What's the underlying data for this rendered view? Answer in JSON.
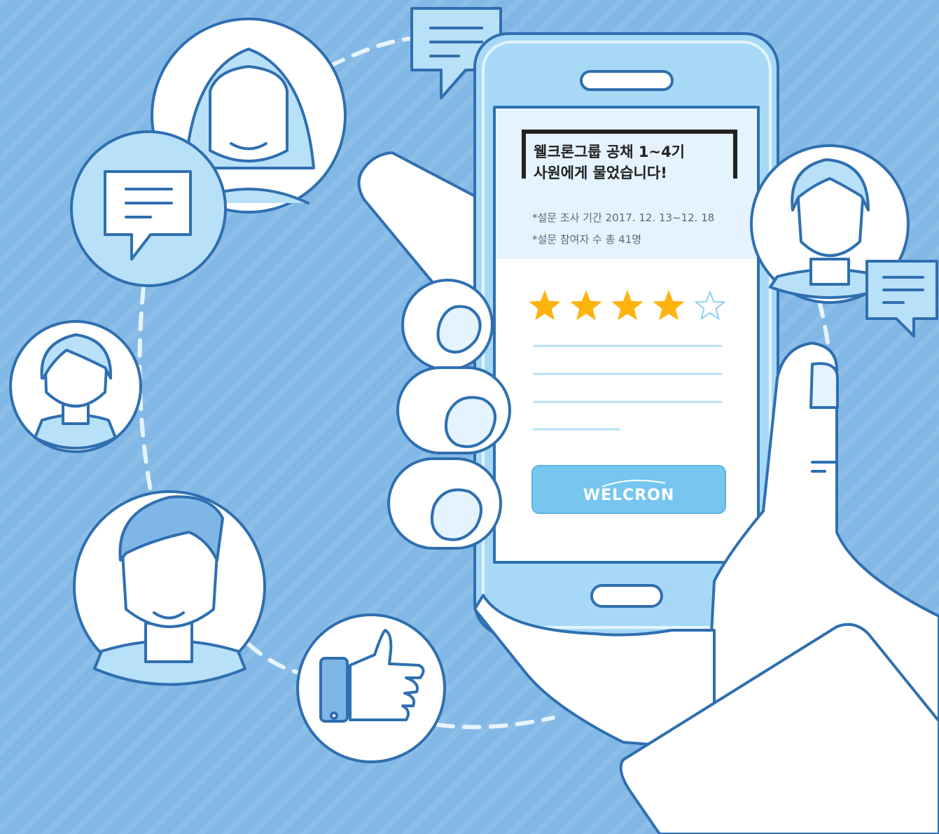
{
  "survey": {
    "title_line1": "웰크론그룹 공채 1~4기",
    "title_line2": "사원에게 물었습니다!",
    "period": "*설문 조사 기간 2017. 12. 13~12. 18",
    "participants": "*설문 참여자 수 총 41명"
  },
  "rating": {
    "value": 4,
    "max": 5
  },
  "brand": {
    "logo_text": "WELCRON"
  },
  "icons": [
    "chat-bubble-icon",
    "thumbs-up-icon",
    "star-icon"
  ],
  "colors": {
    "background": "#82b8e6",
    "outline": "#2f6fb0",
    "light_fill": "#e4f3fd",
    "phone_body": "#a7d9f7",
    "star": "#ffb30f",
    "button": "#76c6f0"
  }
}
